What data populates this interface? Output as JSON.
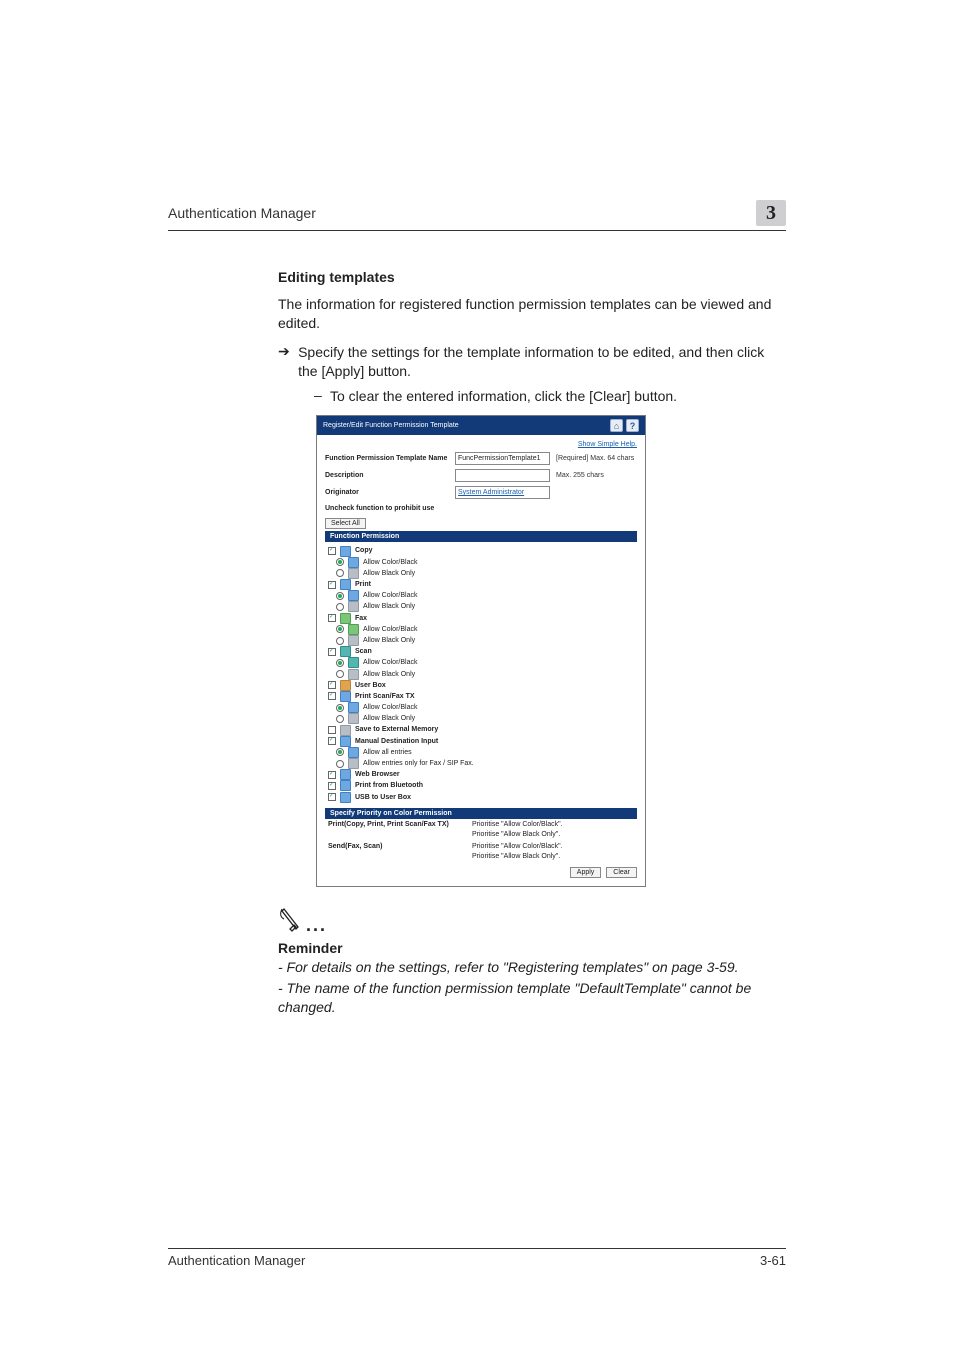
{
  "header": {
    "left": "Authentication Manager",
    "chapter": "3"
  },
  "section": {
    "title": "Editing templates",
    "intro": "The information for registered function permission templates can be viewed and edited.",
    "arrow_intro": "Specify the settings for the template information to be edited, and then click the [Apply] button.",
    "dash_note": "To clear the entered information, click the [Clear] button."
  },
  "screenshot": {
    "title": "Register/Edit Function Permission Template",
    "icons": {
      "home": "⌂",
      "help": "?"
    },
    "help_link": "Show Simple Help.",
    "form": {
      "name_label": "Function Permission Template Name",
      "name_value": "FuncPermissionTemplate1",
      "name_hint": "[Required] Max. 64 chars",
      "desc_label": "Description",
      "desc_value": "",
      "desc_hint": "Max. 255 chars",
      "orig_label": "Originator",
      "orig_value": "System Administrator"
    },
    "uncheck_msg": "Uncheck function to prohibit use",
    "select_all": "Select All",
    "fp_header": "Function Permission",
    "tree": [
      {
        "type": "cb",
        "checked": true,
        "icon": "blue",
        "label": "Copy",
        "bold": true
      },
      {
        "type": "rb",
        "checked": true,
        "indent": 1,
        "icon": "blue",
        "label": "Allow Color/Black"
      },
      {
        "type": "rb",
        "checked": false,
        "indent": 1,
        "icon": "gray",
        "label": "Allow Black Only"
      },
      {
        "type": "cb",
        "checked": true,
        "icon": "blue",
        "label": "Print",
        "bold": true
      },
      {
        "type": "rb",
        "checked": true,
        "indent": 1,
        "icon": "blue",
        "label": "Allow Color/Black"
      },
      {
        "type": "rb",
        "checked": false,
        "indent": 1,
        "icon": "gray",
        "label": "Allow Black Only"
      },
      {
        "type": "cb",
        "checked": true,
        "icon": "green",
        "label": "Fax",
        "bold": true
      },
      {
        "type": "rb",
        "checked": true,
        "indent": 1,
        "icon": "green",
        "label": "Allow Color/Black"
      },
      {
        "type": "rb",
        "checked": false,
        "indent": 1,
        "icon": "gray",
        "label": "Allow Black Only"
      },
      {
        "type": "cb",
        "checked": true,
        "icon": "teal",
        "label": "Scan",
        "bold": true
      },
      {
        "type": "rb",
        "checked": true,
        "indent": 1,
        "icon": "teal",
        "label": "Allow Color/Black"
      },
      {
        "type": "rb",
        "checked": false,
        "indent": 1,
        "icon": "gray",
        "label": "Allow Black Only"
      },
      {
        "type": "cb",
        "checked": true,
        "icon": "orange",
        "label": "User Box",
        "bold": true
      },
      {
        "type": "cb",
        "checked": true,
        "icon": "blue",
        "label": "Print Scan/Fax TX",
        "bold": true
      },
      {
        "type": "rb",
        "checked": true,
        "indent": 1,
        "icon": "blue",
        "label": "Allow Color/Black"
      },
      {
        "type": "rb",
        "checked": false,
        "indent": 1,
        "icon": "gray",
        "label": "Allow Black Only"
      },
      {
        "type": "cb",
        "checked": false,
        "icon": "gray",
        "label": "Save to External Memory",
        "bold": true
      },
      {
        "type": "cb",
        "checked": true,
        "icon": "blue",
        "label": "Manual Destination Input",
        "bold": true
      },
      {
        "type": "rb",
        "checked": true,
        "indent": 1,
        "icon": "blue",
        "label": "Allow all entries"
      },
      {
        "type": "rb",
        "checked": false,
        "indent": 1,
        "icon": "gray",
        "label": "Allow entries only for Fax / SIP Fax."
      },
      {
        "type": "cb",
        "checked": true,
        "icon": "blue",
        "label": "Web Browser",
        "bold": true
      },
      {
        "type": "cb",
        "checked": true,
        "icon": "blue",
        "label": "Print from Bluetooth",
        "bold": true
      },
      {
        "type": "cb",
        "checked": true,
        "icon": "blue",
        "label": "USB to User Box",
        "bold": true
      }
    ],
    "sp_header": "Specify Priority on Color Permission",
    "priority": [
      {
        "label": "Print(Copy, Print, Print Scan/Fax TX)",
        "options": [
          {
            "checked": false,
            "text": "Prioritise \"Allow Color/Black\"."
          },
          {
            "checked": true,
            "text": "Prioritise \"Allow Black Only\"."
          }
        ]
      },
      {
        "label": "Send(Fax, Scan)",
        "options": [
          {
            "checked": false,
            "text": "Prioritise \"Allow Color/Black\"."
          },
          {
            "checked": true,
            "text": "Prioritise \"Allow Black Only\"."
          }
        ]
      }
    ],
    "buttons": {
      "apply": "Apply",
      "clear": "Clear"
    }
  },
  "reminder": {
    "heading": "Reminder",
    "p1": "- For details on the settings, refer to \"Registering templates\" on page 3-59.",
    "p2": "- The name of the function permission template \"DefaultTemplate\" cannot be changed."
  },
  "footer": {
    "left": "Authentication Manager",
    "right": "3-61"
  }
}
